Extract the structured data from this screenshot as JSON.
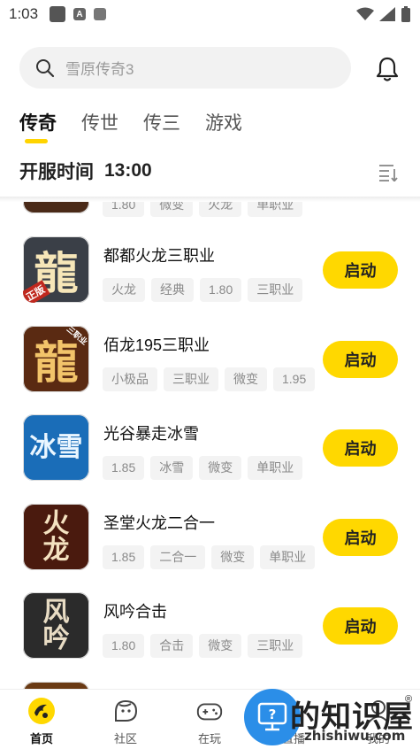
{
  "status_bar": {
    "time": "1:03",
    "a_icon_glyph": "A"
  },
  "search": {
    "placeholder": "雪原传奇3"
  },
  "tabs": [
    {
      "label": "传奇",
      "active": true
    },
    {
      "label": "传世",
      "active": false
    },
    {
      "label": "传三",
      "active": false
    },
    {
      "label": "游戏",
      "active": false
    }
  ],
  "open_time": {
    "label": "开服时间",
    "value": "13:00"
  },
  "partial_top_row": {
    "tags": [
      "1.80",
      "微变",
      "火龙",
      "单职业"
    ]
  },
  "games": [
    {
      "title": "都都火龙三职业",
      "tags": [
        "火龙",
        "经典",
        "1.80",
        "三职业"
      ],
      "button": "启动",
      "icon_glyph": "龍",
      "icon_badge": "正版",
      "icon_color": "#3a3f47"
    },
    {
      "title": "佰龙195三职业",
      "tags": [
        "小极品",
        "三职业",
        "微变",
        "1.95"
      ],
      "button": "启动",
      "icon_glyph": "龍",
      "icon_badge": "三职业",
      "icon_color": "#5a2a12"
    },
    {
      "title": "光谷暴走冰雪",
      "tags": [
        "1.85",
        "冰雪",
        "微变",
        "单职业"
      ],
      "button": "启动",
      "icon_glyph": "冰雪",
      "icon_badge": "",
      "icon_color": "#1a6db8"
    },
    {
      "title": "圣堂火龙二合一",
      "tags": [
        "1.85",
        "二合一",
        "微变",
        "单职业"
      ],
      "button": "启动",
      "icon_glyph": "火龙",
      "icon_badge": "",
      "icon_color": "#4a1a0e"
    },
    {
      "title": "风吟合击",
      "tags": [
        "1.80",
        "合击",
        "微变",
        "三职业"
      ],
      "button": "启动",
      "icon_glyph": "风吟",
      "icon_badge": "",
      "icon_color": "#2b2b2b"
    }
  ],
  "bottom_nav": [
    {
      "label": "首页",
      "icon": "home-logo-icon",
      "active": true
    },
    {
      "label": "社区",
      "icon": "community-face-icon",
      "active": false
    },
    {
      "label": "在玩",
      "icon": "gamepad-icon",
      "active": false
    },
    {
      "label": "直播",
      "icon": "live-icon",
      "active": false
    },
    {
      "label": "我的",
      "icon": "profile-icon",
      "active": false
    }
  ],
  "watermark": {
    "text": "的知识屋",
    "domain": "zhishiwu.com",
    "reg": "®"
  },
  "colors": {
    "accent": "#ffd800",
    "tab_indicator": "#ffd400",
    "tag_bg": "#f3f3f3",
    "watermark_blue": "#2b8ee8"
  }
}
